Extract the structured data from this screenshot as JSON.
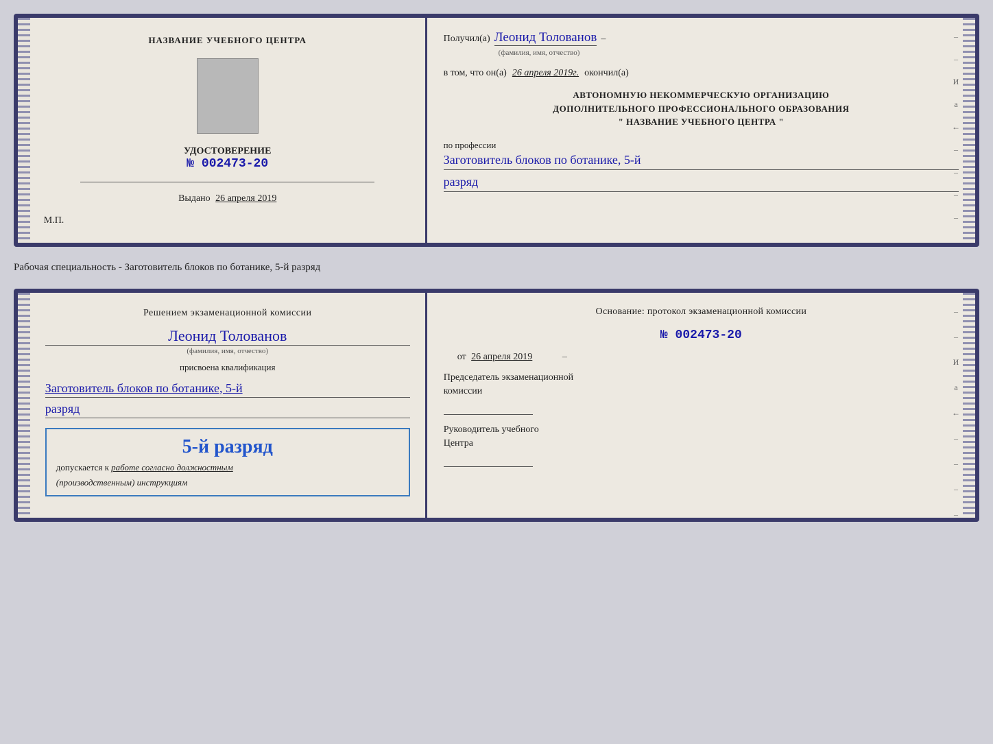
{
  "cert": {
    "left": {
      "title": "НАЗВАНИЕ УЧЕБНОГО ЦЕНТРА",
      "photo_placeholder": "",
      "udostoverenie": "УДОСТОВЕРЕНИЕ",
      "number_label": "№",
      "number": "002473-20",
      "issued_label": "Выдано",
      "issued_date": "26 апреля 2019",
      "mp_label": "М.П."
    },
    "right": {
      "received_label": "Получил(а)",
      "name_handwritten": "Леонид Толованов",
      "name_sublabel": "(фамилия, имя, отчество)",
      "dash": "–",
      "in_that_label": "в том, что он(а)",
      "date_handwritten": "26 апреля 2019г.",
      "finished_label": "окончил(а)",
      "org_line1": "АВТОНОМНУЮ НЕКОММЕРЧЕСКУЮ ОРГАНИЗАЦИЮ",
      "org_line2": "ДОПОЛНИТЕЛЬНОГО ПРОФЕССИОНАЛЬНОГО ОБРАЗОВАНИЯ",
      "org_line3": "\"  НАЗВАНИЕ УЧЕБНОГО ЦЕНТРА   \"",
      "profession_label": "по профессии",
      "profession_handwritten1": "Заготовитель блоков по ботанике, 5-й",
      "rank_handwritten": "разряд"
    }
  },
  "specialty_label": "Рабочая специальность - Заготовитель блоков по ботанике, 5-й разряд",
  "qual": {
    "left": {
      "decision_text": "Решением экзаменационной комиссии",
      "name_handwritten": "Леонид Толованов",
      "name_sublabel": "(фамилия, имя, отчество)",
      "assigned_label": "присвоена квалификация",
      "profession_handwritten": "Заготовитель блоков по ботанике, 5-й",
      "rank_handwritten": "разряд",
      "rank_box": {
        "rank_text": "5-й разряд",
        "allowed_label": "допускается к",
        "allowed_value": "работе согласно должностным",
        "instruction_text": "(производственным) инструкциям"
      }
    },
    "right": {
      "basis_label": "Основание: протокол экзаменационной комиссии",
      "number_label": "№",
      "number": "002473-20",
      "from_label": "от",
      "date": "26 апреля 2019",
      "chairman_label": "Председатель экзаменационной",
      "chairman_label2": "комиссии",
      "head_label": "Руководитель учебного",
      "head_label2": "Центра"
    }
  },
  "margin_chars": [
    "–",
    "–",
    "И",
    "а",
    "←",
    "–",
    "–",
    "–",
    "–"
  ]
}
